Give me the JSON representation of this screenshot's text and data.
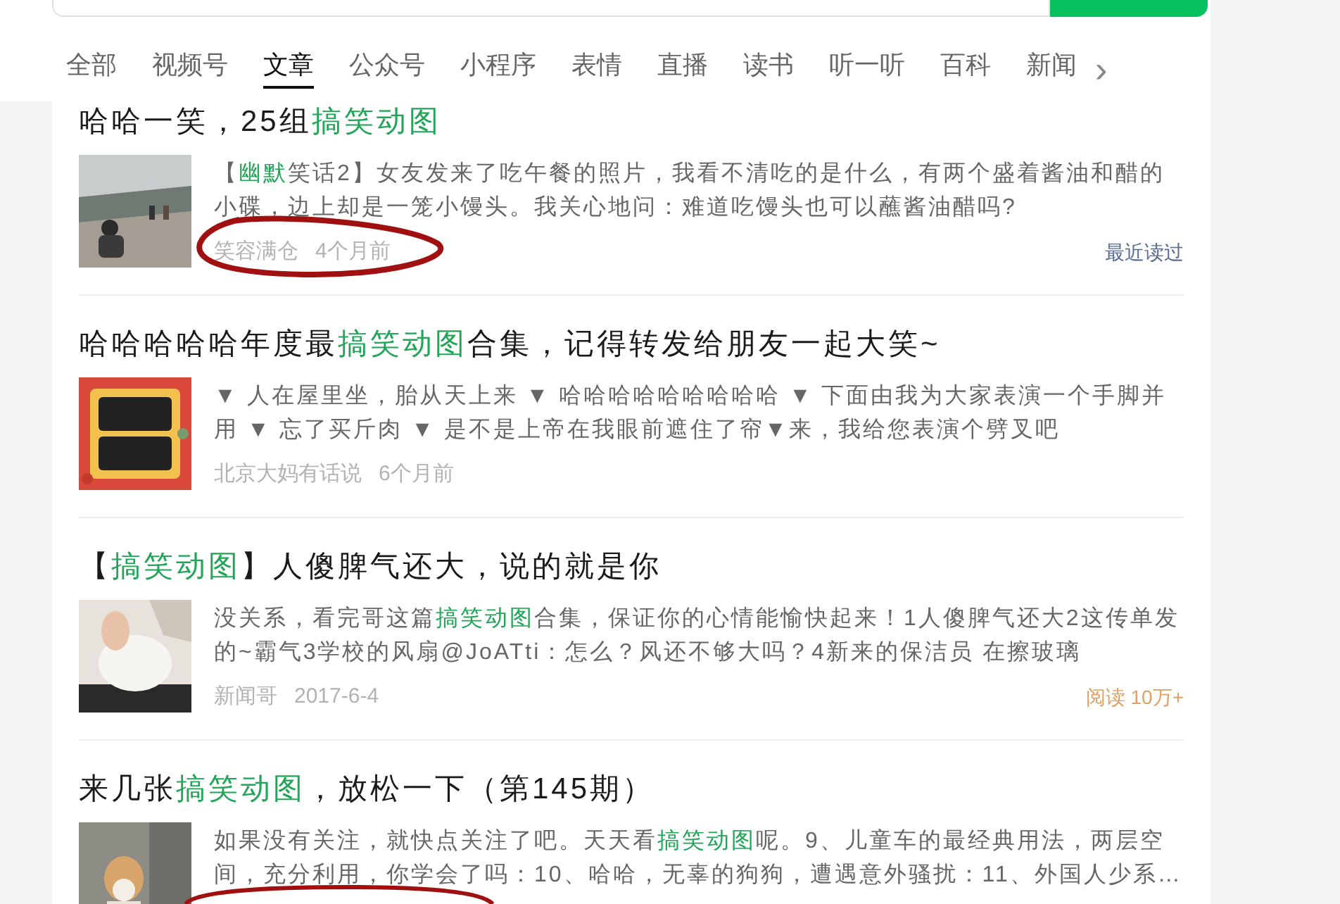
{
  "tabs": [
    {
      "label": "全部",
      "selected": false
    },
    {
      "label": "视频号",
      "selected": false
    },
    {
      "label": "文章",
      "selected": true
    },
    {
      "label": "公众号",
      "selected": false
    },
    {
      "label": "小程序",
      "selected": false
    },
    {
      "label": "表情",
      "selected": false
    },
    {
      "label": "直播",
      "selected": false
    },
    {
      "label": "读书",
      "selected": false
    },
    {
      "label": "听一听",
      "selected": false
    },
    {
      "label": "百科",
      "selected": false
    },
    {
      "label": "新闻",
      "selected": false
    }
  ],
  "tabs_more": "›",
  "articles": [
    {
      "title": [
        {
          "text": "哈哈一笑，25组",
          "highlight": false
        },
        {
          "text": "搞笑动图",
          "highlight": true
        }
      ],
      "thumbnail": {
        "kind": "picture"
      },
      "summary": [
        {
          "text": "【",
          "highlight": false
        },
        {
          "text": "幽默",
          "highlight": true
        },
        {
          "text": "笑话2】女友发来了吃午餐的照片，我看不清吃的是什么，有两个盛着酱油和醋的小碟，边上却是一笼小馒头。我关心地问：难道吃馒头也可以蘸酱油醋吗?",
          "highlight": false
        }
      ],
      "source": "笑容满仓",
      "time": "4个月前",
      "badge": {
        "kind": "recent",
        "text": "最近读过"
      }
    },
    {
      "title": [
        {
          "text": "哈哈哈哈哈年度最",
          "highlight": false
        },
        {
          "text": "搞笑动图",
          "highlight": true
        },
        {
          "text": "合集，记得转发给朋友一起大笑~",
          "highlight": false
        }
      ],
      "thumbnail": {
        "kind": "picture"
      },
      "summary": [
        {
          "text": "▼ 人在屋里坐，胎从天上来 ▼ 哈哈哈哈哈哈哈哈哈 ▼ 下面由我为大家表演一个手脚并用 ▼ 忘了买斤肉 ▼ 是不是上帝在我眼前遮住了帘▼来，我给您表演个劈叉吧",
          "highlight": false
        }
      ],
      "source": "北京大妈有话说",
      "time": "6个月前"
    },
    {
      "title": [
        {
          "text": "【",
          "highlight": false
        },
        {
          "text": "搞笑动图",
          "highlight": true
        },
        {
          "text": "】人傻脾气还大，说的就是你",
          "highlight": false
        }
      ],
      "thumbnail": {
        "kind": "picture"
      },
      "summary": [
        {
          "text": "没关系，看完哥这篇",
          "highlight": false
        },
        {
          "text": "搞笑动图",
          "highlight": true
        },
        {
          "text": "合集，保证你的心情能愉快起来！1人傻脾气还大2这传单发的~霸气3学校的风扇@JoATti：怎么？风还不够大吗？4新来的保洁员 在擦玻璃",
          "highlight": false
        }
      ],
      "source": "新闻哥",
      "time": "2017-6-4",
      "badge": {
        "kind": "reads",
        "text": "阅读 10万+"
      }
    },
    {
      "title": [
        {
          "text": "来几张",
          "highlight": false
        },
        {
          "text": "搞笑动图",
          "highlight": true
        },
        {
          "text": "，放松一下（第145期）",
          "highlight": false
        }
      ],
      "thumbnail": {
        "kind": "picture"
      },
      "summary": [
        {
          "text": "如果没有关注，就快点关注了吧。天天看",
          "highlight": false
        },
        {
          "text": "搞笑动图",
          "highlight": true
        },
        {
          "text": "呢。9、儿童车的最经典用法，两层空间，充分利用，你学会了吗：10、哈哈，无辜的狗狗，遭遇意外骚扰：11、外国人少系…",
          "highlight": false
        }
      ]
    }
  ]
}
